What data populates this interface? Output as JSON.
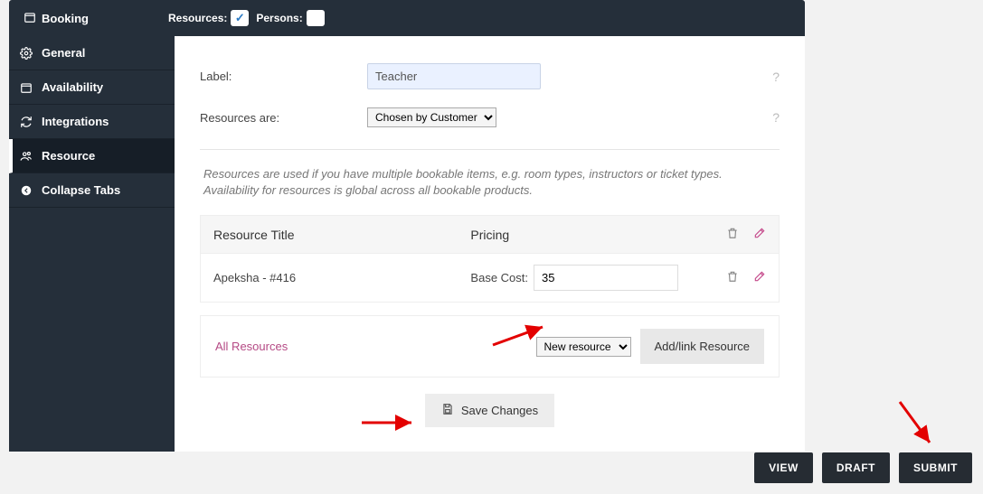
{
  "topbar": {
    "tab_label": "Booking",
    "toggle_resources_label": "Resources:",
    "toggle_persons_label": "Persons:",
    "resources_checked": true,
    "persons_checked": false
  },
  "sidebar": {
    "items": [
      {
        "label": "General",
        "icon": "gear-icon"
      },
      {
        "label": "Availability",
        "icon": "calendar-icon"
      },
      {
        "label": "Integrations",
        "icon": "sync-icon"
      },
      {
        "label": "Resource",
        "icon": "people-icon",
        "active": true
      },
      {
        "label": "Collapse Tabs",
        "icon": "collapse-icon"
      }
    ]
  },
  "form": {
    "label_field": {
      "label": "Label:",
      "value": "Teacher"
    },
    "resources_are": {
      "label": "Resources are:",
      "options": [
        "Chosen by Customer"
      ],
      "selected": "Chosen by Customer"
    },
    "hint": "Resources are used if you have multiple bookable items, e.g. room types, instructors or ticket types. Availability for resources is global across all bookable products."
  },
  "table": {
    "col_title": "Resource Title",
    "col_price": "Pricing",
    "rows": [
      {
        "title": "Apeksha - #416",
        "cost_label": "Base Cost:",
        "cost_value": "35"
      }
    ]
  },
  "link_panel": {
    "all_label": "All Resources",
    "select_options": [
      "New resource"
    ],
    "select_value": "New resource",
    "button_label": "Add/link Resource"
  },
  "save_label": "Save Changes",
  "footer": {
    "view": "VIEW",
    "draft": "DRAFT",
    "submit": "SUBMIT"
  }
}
